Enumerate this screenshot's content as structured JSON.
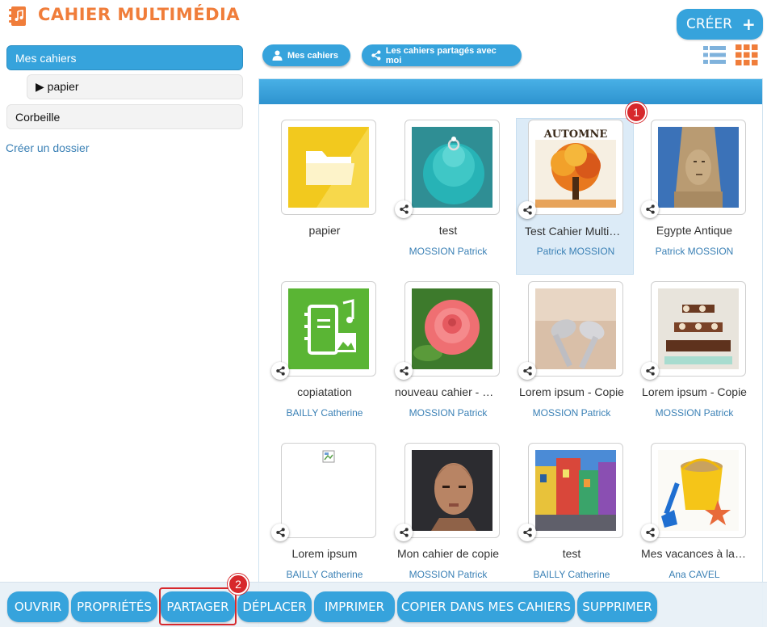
{
  "app": {
    "title": "CAHIER MULTIMÉDIA",
    "create_label": "CRÉER",
    "create_icon": "plus-icon",
    "accent_color": "#36a3dc",
    "title_color": "#f07d3a"
  },
  "sidebar": {
    "items": [
      {
        "label": "Mes cahiers",
        "active": true
      },
      {
        "label": "▶ papier"
      },
      {
        "label": "Corbeille"
      }
    ],
    "create_folder": "Créer un dossier"
  },
  "filters": {
    "mine_label": "Mes cahiers",
    "shared_label": "Les cahiers partagés avec moi"
  },
  "view": {
    "list_icon": "list-view-icon",
    "grid_icon": "grid-view-icon",
    "selected": "grid"
  },
  "cards": [
    {
      "title": "papier",
      "owner": "",
      "image": "folder",
      "shared": false
    },
    {
      "title": "test",
      "owner": "MOSSION Patrick",
      "image": "cupcake-ring",
      "shared": true
    },
    {
      "title": "Test Cahier Multimédia",
      "owner": "Patrick MOSSION",
      "image": "autumn-tree",
      "shared": true,
      "selected": true
    },
    {
      "title": "Egypte Antique",
      "owner": "Patrick MOSSION",
      "image": "sphinx",
      "shared": true
    },
    {
      "title": "copiatation",
      "owner": "BAILLY Catherine",
      "image": "notebook-music",
      "shared": true
    },
    {
      "title": "nouveau cahier - Copie",
      "owner": "MOSSION Patrick",
      "image": "rose",
      "shared": true
    },
    {
      "title": "Lorem ipsum - Copie",
      "owner": "MOSSION Patrick",
      "image": "spoons",
      "shared": true
    },
    {
      "title": "Lorem ipsum - Copie",
      "owner": "MOSSION Patrick",
      "image": "cupcake-tower",
      "shared": true
    },
    {
      "title": "Lorem ipsum",
      "owner": "BAILLY Catherine",
      "image": "broken-image",
      "shared": true
    },
    {
      "title": "Mon cahier de copie",
      "owner": "MOSSION Patrick",
      "image": "nefertiti",
      "shared": true
    },
    {
      "title": "test",
      "owner": "BAILLY Catherine",
      "image": "colorful-houses",
      "shared": true
    },
    {
      "title": "Mes vacances à la mer",
      "owner": "Ana CAVEL",
      "image": "sand-bucket",
      "shared": true
    }
  ],
  "annotations": {
    "step1": "1",
    "step2": "2",
    "color": "#d7282c"
  },
  "toolbar": {
    "open": "OUVRIR",
    "properties": "PROPRIÉTÉS",
    "share": "PARTAGER",
    "move": "DÉPLACER",
    "print": "IMPRIMER",
    "copy": "COPIER DANS MES CAHIERS",
    "delete": "SUPPRIMER"
  }
}
